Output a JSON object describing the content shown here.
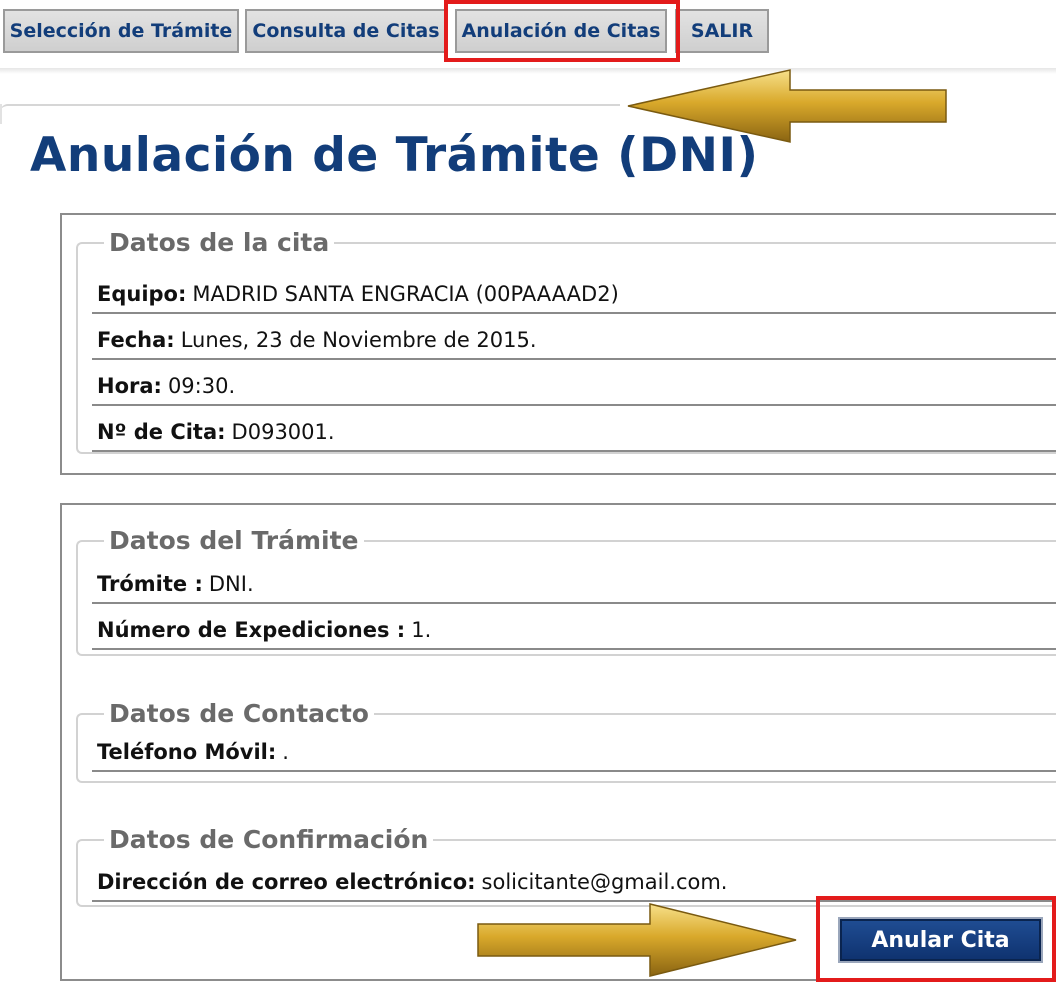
{
  "tabs": [
    {
      "label": "Selección de Trámite"
    },
    {
      "label": "Consulta de Citas"
    },
    {
      "label": "Anulación de Citas"
    },
    {
      "label": "SALIR"
    }
  ],
  "page_title": "Anulación de Trámite (DNI)",
  "cita": {
    "legend": "Datos de la cita",
    "equipo_label": "Equipo:",
    "equipo_value": "MADRID SANTA ENGRACIA (00PAAAAD2)",
    "fecha_label": "Fecha:",
    "fecha_value": "Lunes, 23 de Noviembre de 2015.",
    "hora_label": "Hora:",
    "hora_value": "09:30.",
    "numero_label": "Nº de Cita:",
    "numero_value": "D093001."
  },
  "tramite": {
    "legend": "Datos del Trámite",
    "tramite_label": "Trómite :",
    "tramite_value": "DNI.",
    "expediciones_label": "Número de Expediciones :",
    "expediciones_value": "1."
  },
  "contacto": {
    "legend": "Datos de Contacto",
    "movil_label": "Teléfono Móvil:",
    "movil_value": "."
  },
  "confirmacion": {
    "legend": "Datos de Confirmación",
    "email_label": "Dirección de correo electrónico:",
    "email_value": "solicitante@gmail.com."
  },
  "actions": {
    "anular_label": "Anular Cita"
  },
  "colors": {
    "brand_blue": "#123d7a",
    "highlight_red": "#e31b1b",
    "arrow_gold": "#d9a92b"
  }
}
